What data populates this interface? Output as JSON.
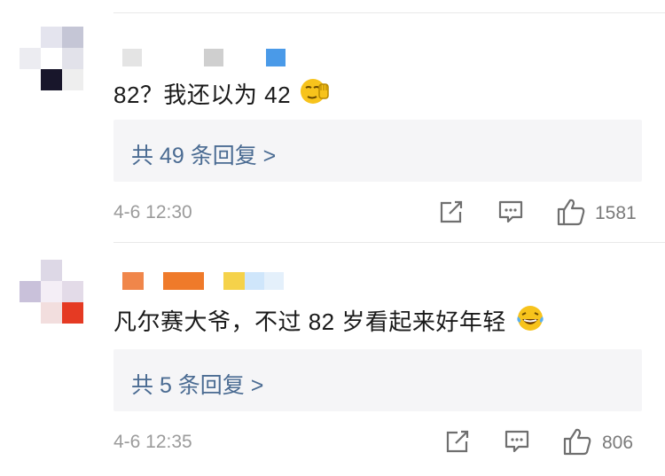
{
  "comments": [
    {
      "text": "82？我还以为 42",
      "emoji_icon": "eye-roll-wave-emoji",
      "replies_label": "共 49 条回复 >",
      "time": "4-6 12:30",
      "like_count": "1581",
      "name_colors": [
        "#d9d9d9",
        "#c9c9c9",
        "#4a9ae8"
      ],
      "avatar_colors": [
        "#e4e4ee",
        "#c5c6d6",
        "#ffffff",
        "#e2e2ea",
        "#18162b",
        "#eeeeee"
      ]
    },
    {
      "text": "凡尔赛大爷，不过 82 岁看起来好年轻",
      "emoji_icon": "tears-of-joy-emoji",
      "replies_label": "共 5 条回复 >",
      "time": "4-6 12:35",
      "like_count": "806",
      "name_colors": [
        "#f0864a",
        "#ef7a2a",
        "#f5d24a",
        "#bfe0ff"
      ],
      "avatar_colors": [
        "#ddd8e6",
        "#c9c1da",
        "#e3dbe8",
        "#e9b3b0",
        "#f2dede",
        "#e53a23"
      ]
    }
  ]
}
